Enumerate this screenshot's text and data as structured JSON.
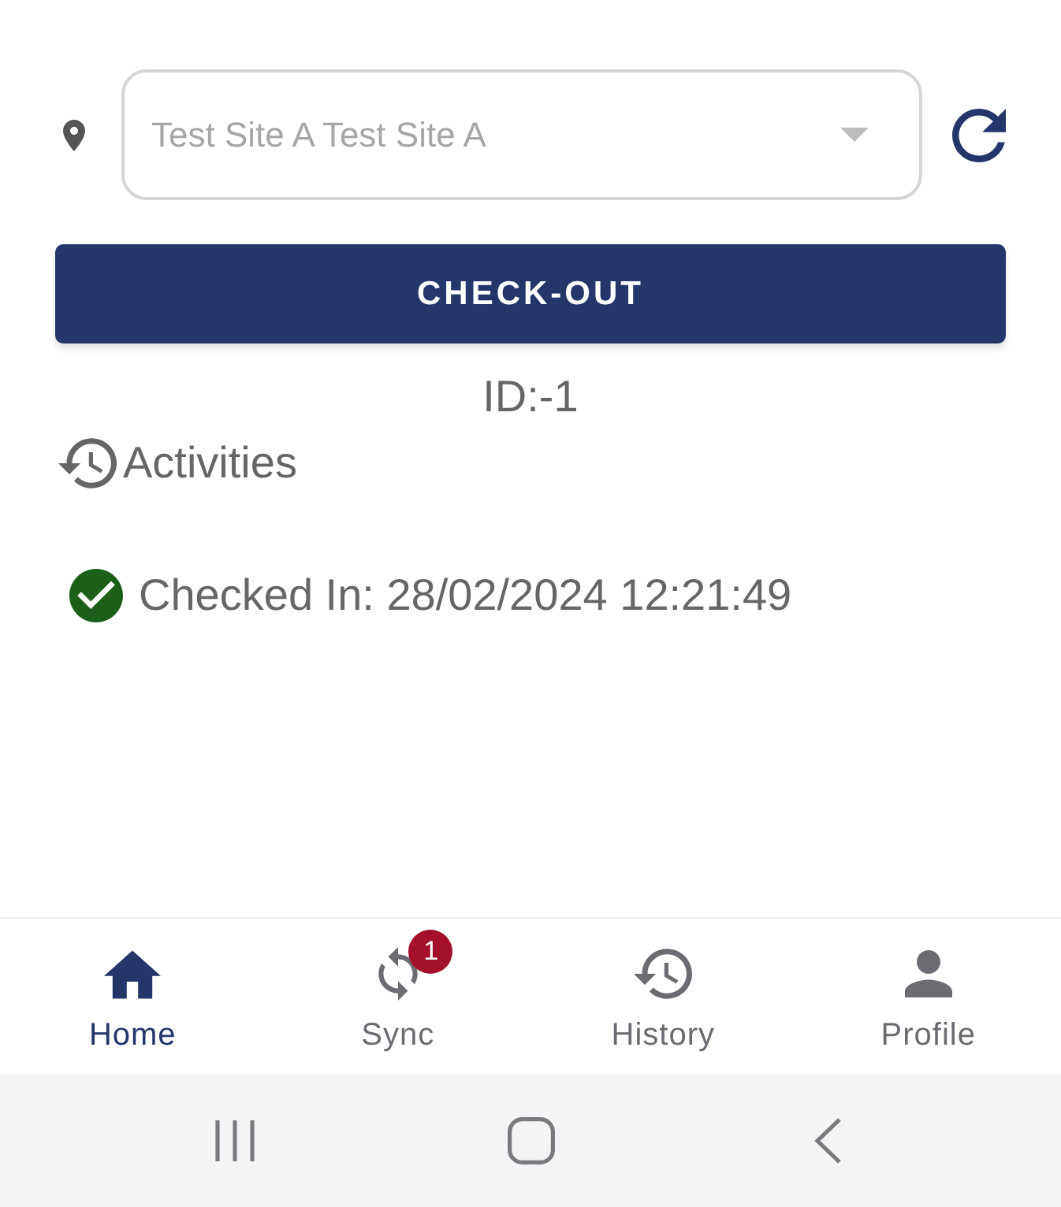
{
  "site_select": {
    "value": "Test Site A Test Site A",
    "disabled": true
  },
  "checkout_button": {
    "label": "CHECK-OUT"
  },
  "id_label": "ID:-1",
  "activities": {
    "title": "Activities",
    "items": [
      {
        "kind": "checked_in",
        "text": "Checked In: 28/02/2024 12:21:49"
      }
    ]
  },
  "nav": {
    "items": [
      {
        "label": "Home",
        "selected": true
      },
      {
        "label": "Sync",
        "selected": false,
        "badge": "1"
      },
      {
        "label": "History",
        "selected": false
      },
      {
        "label": "Profile",
        "selected": false
      }
    ]
  }
}
